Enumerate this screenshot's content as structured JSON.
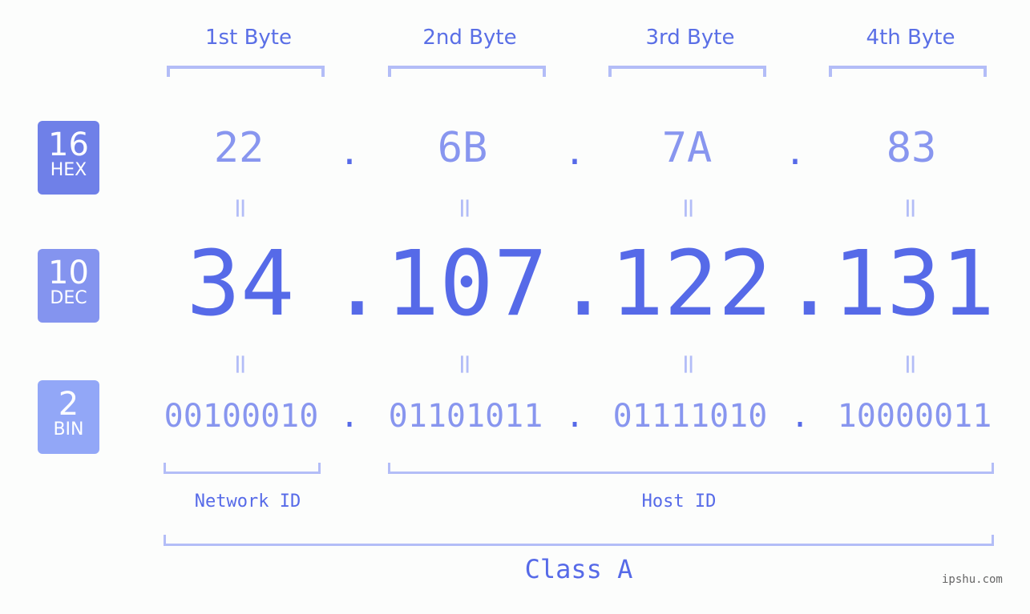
{
  "bases": [
    {
      "num": "16",
      "label": "HEX",
      "color": "#6f80e8"
    },
    {
      "num": "10",
      "label": "DEC",
      "color": "#8494ef"
    },
    {
      "num": "2",
      "label": "BIN",
      "color": "#92a7f7"
    }
  ],
  "byte_labels": [
    "1st Byte",
    "2nd Byte",
    "3rd Byte",
    "4th Byte"
  ],
  "hex": [
    "22",
    "6B",
    "7A",
    "83"
  ],
  "dec": [
    "34",
    "107",
    "122",
    "131"
  ],
  "bin": [
    "00100010",
    "01101011",
    "01111010",
    "10000011"
  ],
  "separator": ".",
  "equals": "=",
  "network_label": "Network ID",
  "host_label": "Host ID",
  "class_label": "Class A",
  "watermark": "ipshu.com",
  "colors": {
    "accent": "#566ae8",
    "light": "#8896ef",
    "bracket": "#b3bdf7"
  }
}
